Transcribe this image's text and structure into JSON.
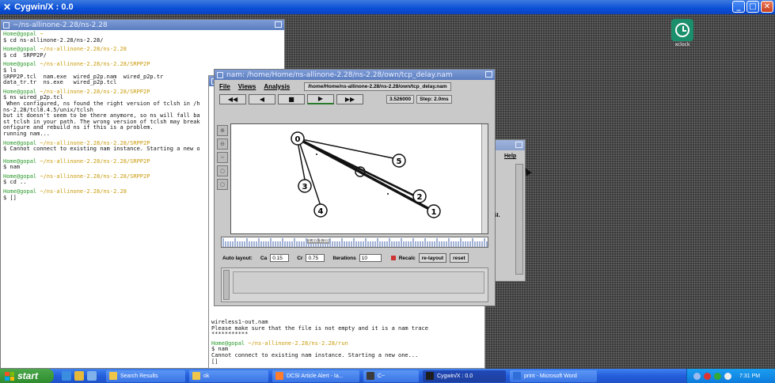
{
  "outer_window": {
    "title": "Cygwin/X : 0.0"
  },
  "xclock": {
    "label": "xclock"
  },
  "terminal1": {
    "title": "~/ns-allinone-2.28/ns-2.28",
    "lines": [
      {
        "t": "p",
        "text": "Home@gopal ~"
      },
      {
        "t": "c",
        "text": "$ cd ns-allinone-2.28/ns-2.28/"
      },
      {
        "t": "g"
      },
      {
        "t": "p",
        "text": "Home@gopal ~/ns-allinone-2.28/ns-2.28"
      },
      {
        "t": "c",
        "text": "$ cd  SRPP2P/"
      },
      {
        "t": "g"
      },
      {
        "t": "p",
        "text": "Home@gopal ~/ns-allinone-2.28/ns-2.28/SRPP2P"
      },
      {
        "t": "c",
        "text": "$ ls"
      },
      {
        "t": "c",
        "text": "SRPP2P.tcl  nam.exe  wired_p2p.nam  wired_p2p.tr"
      },
      {
        "t": "c",
        "text": "data_tr.tr  ns.exe   wired_p2p.tcl"
      },
      {
        "t": "g"
      },
      {
        "t": "p",
        "text": "Home@gopal ~/ns-allinone-2.28/ns-2.28/SRPP2P"
      },
      {
        "t": "c",
        "text": "$ ns wired_p2p.tcl"
      },
      {
        "t": "c",
        "text": " When configured, ns found the right version of tclsh in /h"
      },
      {
        "t": "c",
        "text": "ns-2.28/tcl8.4.5/unix/tclsh"
      },
      {
        "t": "c",
        "text": "but it doesn't seem to be there anymore, so ns will fall ba"
      },
      {
        "t": "c",
        "text": "st tclsh in your path. The wrong version of tclsh may break"
      },
      {
        "t": "c",
        "text": "onfigure and rebuild ns if this is a problem."
      },
      {
        "t": "c",
        "text": "running nam..."
      },
      {
        "t": "g"
      },
      {
        "t": "p",
        "text": "Home@gopal ~/ns-allinone-2.28/ns-2.28/SRPP2P"
      },
      {
        "t": "c",
        "text": "$ Cannot connect to existing nam instance. Starting a new o"
      },
      {
        "t": "g"
      },
      {
        "t": "g"
      },
      {
        "t": "p",
        "text": "Home@gopal ~/ns-allinone-2.28/ns-2.28/SRPP2P"
      },
      {
        "t": "c",
        "text": "$ nam"
      },
      {
        "t": "g"
      },
      {
        "t": "p",
        "text": "Home@gopal ~/ns-allinone-2.28/ns-2.28/SRPP2P"
      },
      {
        "t": "c",
        "text": "$ cd .."
      },
      {
        "t": "g"
      },
      {
        "t": "p",
        "text": "Home@gopal ~/ns-allinone-2.28/ns-2.28"
      },
      {
        "t": "c",
        "text": "$ []"
      }
    ]
  },
  "terminal2": {
    "lines": [
      {
        "t": "c",
        "text": "wireless1-out.nam"
      },
      {
        "t": "c",
        "text": "Please make sure that the file is not empty and it is a nam trace"
      },
      {
        "t": "c",
        "text": "***********"
      },
      {
        "t": "g"
      },
      {
        "t": "p",
        "text": "Home@gopal ~/ns-allinone-2.28/ns-2.28/run"
      },
      {
        "t": "c",
        "text": "$ nam"
      },
      {
        "t": "c",
        "text": "Cannot connect to existing nam instance. Starting a new one..."
      },
      {
        "t": "c",
        "text": "[]"
      }
    ]
  },
  "nam": {
    "title": "nam: /home/Home/ns-allinone-2.28/ns-2.28/own/tcp_delay.nam",
    "menu": [
      "File",
      "Views",
      "Analysis"
    ],
    "file_path": "/home/Home/ns-allinone-2.28/ns-2.28/own/tcp_delay.nam",
    "controls": [
      {
        "name": "rewind-button",
        "glyph": "◀◀"
      },
      {
        "name": "back-button",
        "glyph": "◀"
      },
      {
        "name": "stop-button",
        "glyph": "■"
      },
      {
        "name": "play-button",
        "glyph": "▶"
      },
      {
        "name": "fast-forward-button",
        "glyph": "▶▶"
      }
    ],
    "time": "3.526000",
    "step": "Step: 2.0ms",
    "tools": [
      "⊕",
      "⊖",
      "",
      "",
      ""
    ],
    "nodes": [
      "0",
      "1",
      "2",
      "3",
      "4",
      "5"
    ],
    "timeline_label": "1.60 3.20",
    "layout": {
      "auto_label": "Auto layout:",
      "ca_label": "Ca",
      "ca_value": "0.15",
      "cr_label": "Cr",
      "cr_value": "0.75",
      "iter_label": "Iterations",
      "iter_value": "10",
      "recalc_label": "Recalc",
      "relayout_label": "re-layout",
      "reset_label": "reset"
    }
  },
  "back_window": {
    "help_label": "Help",
    "partial_text": "SI."
  },
  "taskbar": {
    "start_label": "start",
    "tasks": [
      {
        "label": "Search Results",
        "color": "#f0c64a"
      },
      {
        "label": "ok",
        "color": "#f0c64a"
      },
      {
        "label": "DCSI Article Alert - Ia...",
        "color": "#ff7b2e"
      },
      {
        "label": "C~",
        "color": "#3c3c3c"
      },
      {
        "label": "Cygwin/X : 0.0",
        "color": "#1e1e1e",
        "active": true
      },
      {
        "label": "print - Microsoft Word",
        "color": "#2f6ed8"
      }
    ],
    "clock": "7:31 PM"
  },
  "colors": {
    "accent": "#245edb",
    "prompt": "#2b9a2b",
    "path": "#c99a0a"
  }
}
